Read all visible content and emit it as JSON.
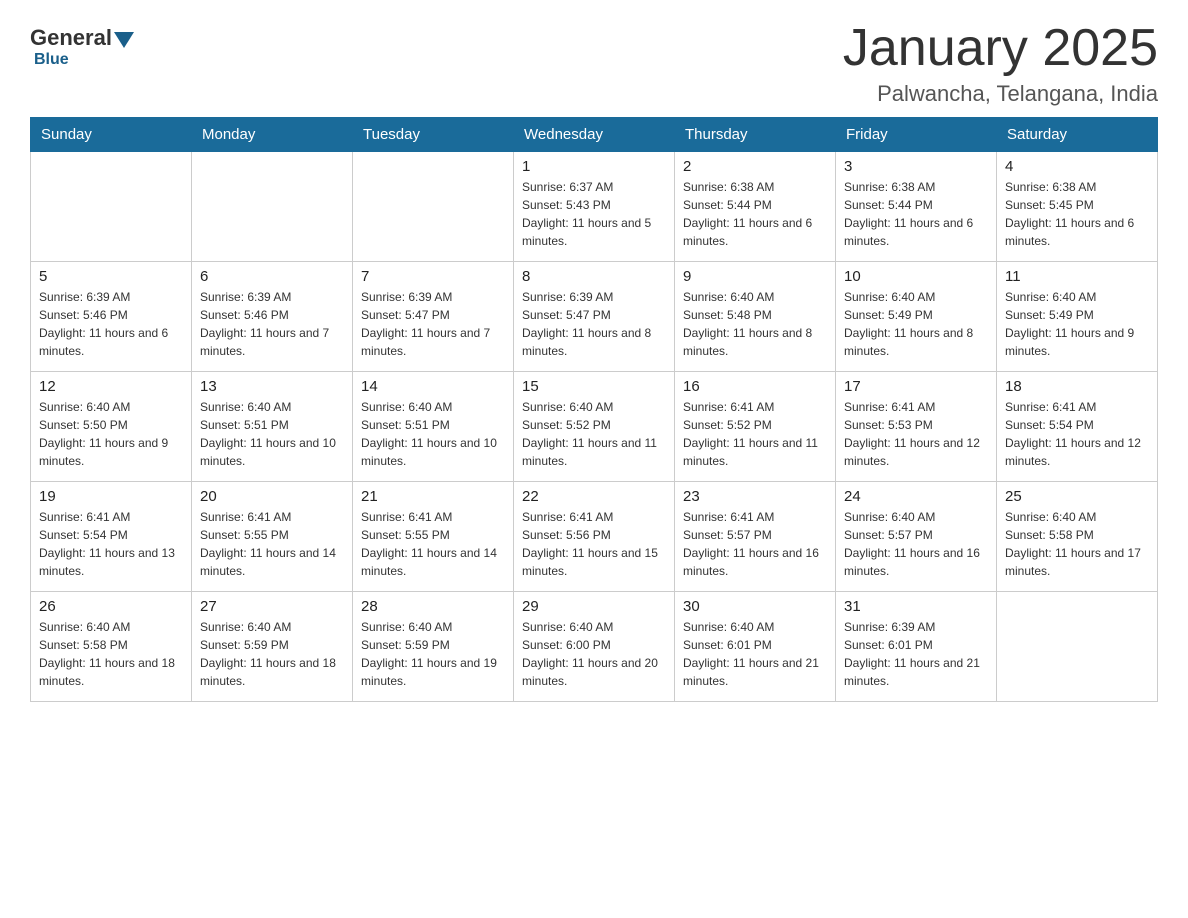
{
  "header": {
    "logo": {
      "general": "General",
      "blue": "Blue"
    },
    "title": "January 2025",
    "location": "Palwancha, Telangana, India"
  },
  "weekdays": [
    "Sunday",
    "Monday",
    "Tuesday",
    "Wednesday",
    "Thursday",
    "Friday",
    "Saturday"
  ],
  "weeks": [
    [
      {
        "day": "",
        "info": ""
      },
      {
        "day": "",
        "info": ""
      },
      {
        "day": "",
        "info": ""
      },
      {
        "day": "1",
        "info": "Sunrise: 6:37 AM\nSunset: 5:43 PM\nDaylight: 11 hours and 5 minutes."
      },
      {
        "day": "2",
        "info": "Sunrise: 6:38 AM\nSunset: 5:44 PM\nDaylight: 11 hours and 6 minutes."
      },
      {
        "day": "3",
        "info": "Sunrise: 6:38 AM\nSunset: 5:44 PM\nDaylight: 11 hours and 6 minutes."
      },
      {
        "day": "4",
        "info": "Sunrise: 6:38 AM\nSunset: 5:45 PM\nDaylight: 11 hours and 6 minutes."
      }
    ],
    [
      {
        "day": "5",
        "info": "Sunrise: 6:39 AM\nSunset: 5:46 PM\nDaylight: 11 hours and 6 minutes."
      },
      {
        "day": "6",
        "info": "Sunrise: 6:39 AM\nSunset: 5:46 PM\nDaylight: 11 hours and 7 minutes."
      },
      {
        "day": "7",
        "info": "Sunrise: 6:39 AM\nSunset: 5:47 PM\nDaylight: 11 hours and 7 minutes."
      },
      {
        "day": "8",
        "info": "Sunrise: 6:39 AM\nSunset: 5:47 PM\nDaylight: 11 hours and 8 minutes."
      },
      {
        "day": "9",
        "info": "Sunrise: 6:40 AM\nSunset: 5:48 PM\nDaylight: 11 hours and 8 minutes."
      },
      {
        "day": "10",
        "info": "Sunrise: 6:40 AM\nSunset: 5:49 PM\nDaylight: 11 hours and 8 minutes."
      },
      {
        "day": "11",
        "info": "Sunrise: 6:40 AM\nSunset: 5:49 PM\nDaylight: 11 hours and 9 minutes."
      }
    ],
    [
      {
        "day": "12",
        "info": "Sunrise: 6:40 AM\nSunset: 5:50 PM\nDaylight: 11 hours and 9 minutes."
      },
      {
        "day": "13",
        "info": "Sunrise: 6:40 AM\nSunset: 5:51 PM\nDaylight: 11 hours and 10 minutes."
      },
      {
        "day": "14",
        "info": "Sunrise: 6:40 AM\nSunset: 5:51 PM\nDaylight: 11 hours and 10 minutes."
      },
      {
        "day": "15",
        "info": "Sunrise: 6:40 AM\nSunset: 5:52 PM\nDaylight: 11 hours and 11 minutes."
      },
      {
        "day": "16",
        "info": "Sunrise: 6:41 AM\nSunset: 5:52 PM\nDaylight: 11 hours and 11 minutes."
      },
      {
        "day": "17",
        "info": "Sunrise: 6:41 AM\nSunset: 5:53 PM\nDaylight: 11 hours and 12 minutes."
      },
      {
        "day": "18",
        "info": "Sunrise: 6:41 AM\nSunset: 5:54 PM\nDaylight: 11 hours and 12 minutes."
      }
    ],
    [
      {
        "day": "19",
        "info": "Sunrise: 6:41 AM\nSunset: 5:54 PM\nDaylight: 11 hours and 13 minutes."
      },
      {
        "day": "20",
        "info": "Sunrise: 6:41 AM\nSunset: 5:55 PM\nDaylight: 11 hours and 14 minutes."
      },
      {
        "day": "21",
        "info": "Sunrise: 6:41 AM\nSunset: 5:55 PM\nDaylight: 11 hours and 14 minutes."
      },
      {
        "day": "22",
        "info": "Sunrise: 6:41 AM\nSunset: 5:56 PM\nDaylight: 11 hours and 15 minutes."
      },
      {
        "day": "23",
        "info": "Sunrise: 6:41 AM\nSunset: 5:57 PM\nDaylight: 11 hours and 16 minutes."
      },
      {
        "day": "24",
        "info": "Sunrise: 6:40 AM\nSunset: 5:57 PM\nDaylight: 11 hours and 16 minutes."
      },
      {
        "day": "25",
        "info": "Sunrise: 6:40 AM\nSunset: 5:58 PM\nDaylight: 11 hours and 17 minutes."
      }
    ],
    [
      {
        "day": "26",
        "info": "Sunrise: 6:40 AM\nSunset: 5:58 PM\nDaylight: 11 hours and 18 minutes."
      },
      {
        "day": "27",
        "info": "Sunrise: 6:40 AM\nSunset: 5:59 PM\nDaylight: 11 hours and 18 minutes."
      },
      {
        "day": "28",
        "info": "Sunrise: 6:40 AM\nSunset: 5:59 PM\nDaylight: 11 hours and 19 minutes."
      },
      {
        "day": "29",
        "info": "Sunrise: 6:40 AM\nSunset: 6:00 PM\nDaylight: 11 hours and 20 minutes."
      },
      {
        "day": "30",
        "info": "Sunrise: 6:40 AM\nSunset: 6:01 PM\nDaylight: 11 hours and 21 minutes."
      },
      {
        "day": "31",
        "info": "Sunrise: 6:39 AM\nSunset: 6:01 PM\nDaylight: 11 hours and 21 minutes."
      },
      {
        "day": "",
        "info": ""
      }
    ]
  ]
}
